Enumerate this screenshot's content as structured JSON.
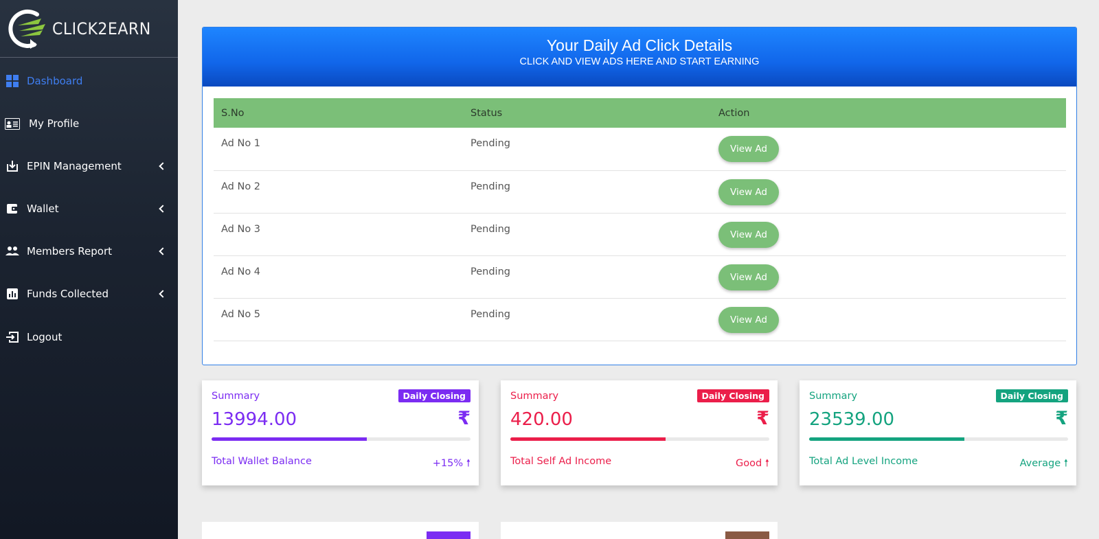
{
  "brand": {
    "name": "CLICK2EARN",
    "logo_icon": "c2e-logo-icon"
  },
  "sidebar": {
    "items": [
      {
        "label": "Dashboard",
        "icon": "dashboard-grid-icon",
        "active": true,
        "has_submenu": false
      },
      {
        "label": "My Profile",
        "icon": "id-card-icon",
        "active": false,
        "has_submenu": false
      },
      {
        "label": "EPIN Management",
        "icon": "download-box-icon",
        "active": false,
        "has_submenu": true
      },
      {
        "label": "Wallet",
        "icon": "wallet-icon",
        "active": false,
        "has_submenu": true
      },
      {
        "label": "Members Report",
        "icon": "people-icon",
        "active": false,
        "has_submenu": true
      },
      {
        "label": "Funds Collected",
        "icon": "bar-chart-icon",
        "active": false,
        "has_submenu": true
      },
      {
        "label": "Logout",
        "icon": "logout-icon",
        "active": false,
        "has_submenu": false
      }
    ]
  },
  "ad_panel": {
    "title": "Your Daily Ad Click Details",
    "subtitle": "CLICK AND VIEW ADS HERE AND START EARNING",
    "columns": [
      "S.No",
      "Status",
      "Action"
    ],
    "rows": [
      {
        "sno": "Ad No 1",
        "status": "Pending",
        "action": "View Ad"
      },
      {
        "sno": "Ad No 2",
        "status": "Pending",
        "action": "View Ad"
      },
      {
        "sno": "Ad No 3",
        "status": "Pending",
        "action": "View Ad"
      },
      {
        "sno": "Ad No 4",
        "status": "Pending",
        "action": "View Ad"
      },
      {
        "sno": "Ad No 5",
        "status": "Pending",
        "action": "View Ad"
      }
    ]
  },
  "summary_cards": [
    {
      "label": "Summary",
      "badge": "Daily Closing",
      "value": "13994.00",
      "currency": "₹",
      "progress": 0.6,
      "footer": "Total Wallet Balance",
      "trend": "+15%",
      "color": "#7b2cf2"
    },
    {
      "label": "Summary",
      "badge": "Daily Closing",
      "value": "420.00",
      "currency": "₹",
      "progress": 0.6,
      "footer": "Total Self Ad Income",
      "trend": "Good",
      "color": "#eb1e4a"
    },
    {
      "label": "Summary",
      "badge": "Daily Closing",
      "value": "23539.00",
      "currency": "₹",
      "progress": 0.6,
      "footer": "Total Ad Level Income",
      "trend": "Average",
      "color": "#14a37f"
    }
  ],
  "colors": {
    "header_blue": "#1166ea",
    "table_green": "#7bbf78",
    "peek_purple": "#7b2cf2",
    "peek_brown": "#8a5a44"
  }
}
